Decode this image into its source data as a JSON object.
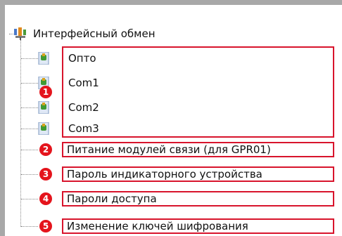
{
  "tree": {
    "root_label": "Интерфейсный обмен",
    "root_icon": "network-interfaces-icon",
    "channels": [
      {
        "label": "Опто",
        "icon": "port-node-icon"
      },
      {
        "label": "Com1",
        "icon": "port-node-icon"
      },
      {
        "label": "Com2",
        "icon": "port-node-icon"
      },
      {
        "label": "Com3",
        "icon": "port-node-icon"
      }
    ],
    "items": [
      {
        "label": "Питание модулей связи (для GPR01)"
      },
      {
        "label": "Пароль индикаторного устройства"
      },
      {
        "label": "Пароли доступа"
      },
      {
        "label": "Изменение ключей шифрования"
      }
    ]
  },
  "annotations": {
    "badges": [
      "1",
      "2",
      "3",
      "4",
      "5"
    ],
    "color": "#d8142c"
  }
}
